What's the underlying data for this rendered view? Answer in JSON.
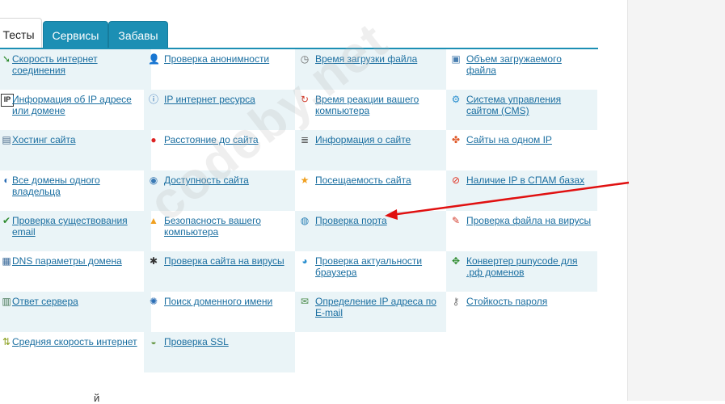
{
  "tabs": [
    {
      "label": "Тесты",
      "active": true
    },
    {
      "label": "Сервисы",
      "active": false
    },
    {
      "label": "Забавы",
      "active": false
    }
  ],
  "colors": {
    "accent": "#1c8fb4",
    "link": "#1a6ea0",
    "shade": "#eaf4f7",
    "annotation": "#e01010"
  },
  "watermark": "codeby.net",
  "bottom_fragment": "й",
  "rows": [
    [
      {
        "label": "Скорость интернет соединения",
        "icon": "speed-arrow-icon"
      },
      {
        "label": "Проверка анонимности",
        "icon": "anonymous-person-icon"
      },
      {
        "label": "Время загрузки файла",
        "icon": "clock-icon"
      },
      {
        "label": "Объем загружаемого файла",
        "icon": "file-size-icon"
      }
    ],
    [
      {
        "label": "Информация об IP адресе или домене",
        "icon": "ip-info-icon"
      },
      {
        "label": "IP интернет ресурса",
        "icon": "ip-resource-icon"
      },
      {
        "label": "Время реакции вашего компьютера",
        "icon": "refresh-icon"
      },
      {
        "label": "Система управления сайтом (CMS)",
        "icon": "cms-gear-icon"
      }
    ],
    [
      {
        "label": "Хостинг сайта",
        "icon": "server-icon"
      },
      {
        "label": "Расстояние до сайта",
        "icon": "map-pin-icon"
      },
      {
        "label": "Информация о сайте",
        "icon": "document-icon"
      },
      {
        "label": "Сайты на одном IP",
        "icon": "network-icon"
      }
    ],
    [
      {
        "label": "Все домены одного владельца",
        "icon": "owner-icon"
      },
      {
        "label": "Доступность сайта",
        "icon": "availability-icon"
      },
      {
        "label": "Посещаемость сайта",
        "icon": "star-icon"
      },
      {
        "label": "Наличие IP в СПАМ базах",
        "icon": "spam-block-icon"
      }
    ],
    [
      {
        "label": "Проверка существования email",
        "icon": "email-check-icon"
      },
      {
        "label": "Безопасность вашего компьютера",
        "icon": "padlock-icon"
      },
      {
        "label": "Проверка порта",
        "icon": "globe-icon"
      },
      {
        "label": "Проверка файла на вирусы",
        "icon": "virus-file-icon"
      }
    ],
    [
      {
        "label": "DNS параметры домена",
        "icon": "dns-icon"
      },
      {
        "label": "Проверка сайта на вирусы",
        "icon": "bug-icon"
      },
      {
        "label": "Проверка актуальности браузера",
        "icon": "browser-icon"
      },
      {
        "label": "Конвертер punycode для .рф доменов",
        "icon": "converter-icon"
      }
    ],
    [
      {
        "label": "Ответ сервера",
        "icon": "server-response-icon"
      },
      {
        "label": "Поиск доменного имени",
        "icon": "domain-search-icon"
      },
      {
        "label": "Определение IP адреса по E-mail",
        "icon": "email-ip-icon"
      },
      {
        "label": "Стойкость пароля",
        "icon": "key-icon"
      }
    ],
    [
      {
        "label": "Средняя скорость интернет",
        "icon": "average-speed-icon"
      },
      {
        "label": "Проверка SSL",
        "icon": "ssl-icon"
      }
    ]
  ]
}
